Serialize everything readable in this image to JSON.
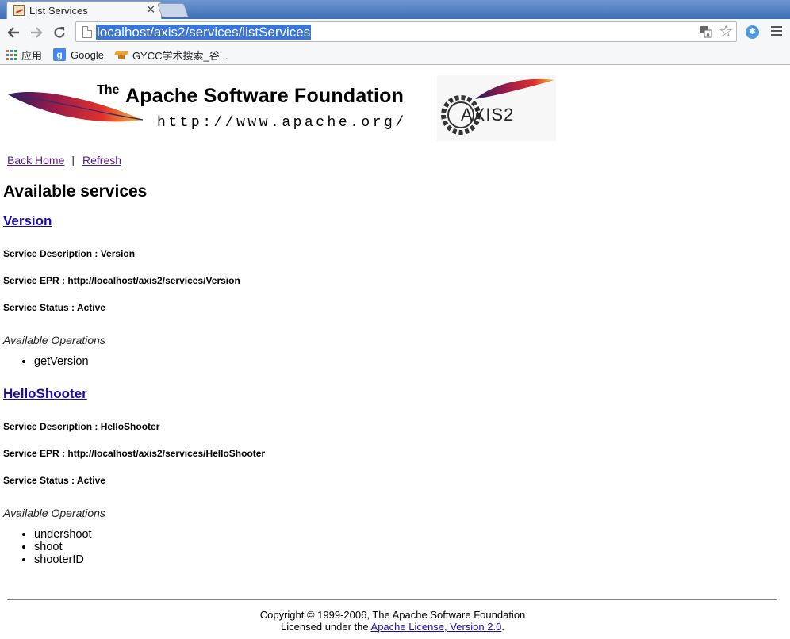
{
  "browser": {
    "tab_title": "List Services",
    "tab_close": "✕",
    "url": "localhost/axis2/services/listServices",
    "bookmarks": [
      {
        "label": "应用",
        "icon": "apps-icon"
      },
      {
        "label": "Google",
        "icon": "google-icon"
      },
      {
        "label": "GYCC学术搜索_谷...",
        "icon": "scholar-hat-icon"
      }
    ]
  },
  "banner": {
    "the": "The",
    "name": "Apache Software Foundation",
    "url": "http://www.apache.org/",
    "axis_logo_text": "AXIS2"
  },
  "nav": {
    "back_home": "Back Home",
    "separator": "|",
    "refresh": "Refresh"
  },
  "page_title": "Available services",
  "services": [
    {
      "name": "Version",
      "description": "Service Description : Version",
      "epr": "Service EPR : http://localhost/axis2/services/Version",
      "status": "Service Status : Active",
      "ops_title": "Available Operations",
      "operations": [
        "getVersion"
      ]
    },
    {
      "name": "HelloShooter",
      "description": "Service Description : HelloShooter",
      "epr": "Service EPR : http://localhost/axis2/services/HelloShooter",
      "status": "Service Status : Active",
      "ops_title": "Available Operations",
      "operations": [
        "undershoot",
        "shoot",
        "shooterID"
      ]
    }
  ],
  "footer": {
    "copyright": "Copyright © 1999-2006, The Apache Software Foundation",
    "licensed_prefix": "Licensed under the ",
    "license_link": "Apache License, Version 2.0",
    "licensed_suffix": "."
  },
  "colors": {
    "link": "#1a0dab",
    "visited": "#551a8b",
    "url_highlight": "#3a76d8"
  }
}
